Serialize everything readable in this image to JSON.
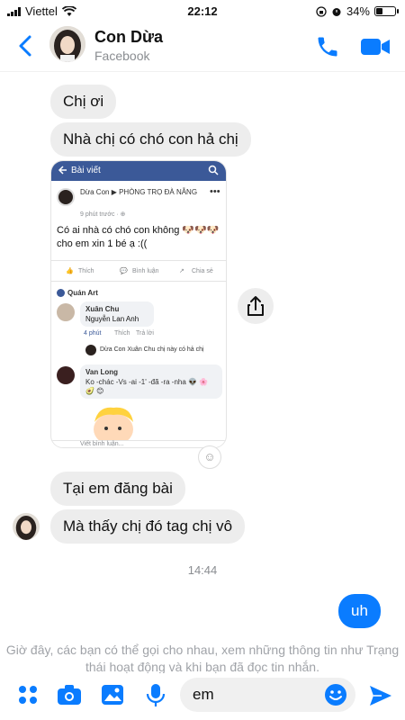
{
  "status": {
    "carrier": "Viettel",
    "time": "22:12",
    "battery": "34%",
    "battery_level": 0.34
  },
  "header": {
    "name": "Con Dừa",
    "subtitle": "Facebook"
  },
  "messages": [
    {
      "from": "them",
      "text": "Chị ơi"
    },
    {
      "from": "them",
      "text": "Nhà chị có chó con hả chị"
    },
    {
      "from": "them",
      "text": "Tại em đăng bài"
    },
    {
      "from": "them",
      "text": "Mà thấy chị đó tag chị vô"
    },
    {
      "from": "me",
      "text": "uh"
    }
  ],
  "timestamp": "14:44",
  "shared_image": {
    "topbar_title": "Bài viết",
    "poster": "Dừa Con ▶ PHÒNG TRỌ ĐÀ NẴNG",
    "post_time": "9 phút trước · ⊕",
    "post_text": "Có ai nhà có chó con không 🐶🐶🐶 cho em xin 1 bé ạ :((",
    "like": "Thích",
    "comment": "Bình luận",
    "share": "Chia sẻ",
    "group_tag": "Quán Art",
    "c1_name": "Xuân Chu",
    "c1_text": "Nguyễn Lan Anh",
    "c1_time": "4 phút",
    "c1_like": "Thích",
    "c1_reply": "Trả lời",
    "reply_text": "Dừa Con Xuân Chu  chị này có hả chị",
    "c2_name": "Van Long",
    "c2_text": "Ko -chác -Vs -ai -1' -đã -ra -nha 👽 🌸 🥑 😊",
    "write_comment": "Viết bình luận..."
  },
  "composer": {
    "notice": "Giờ đây, các bạn có thể gọi cho nhau, xem những thông tin như Trạng thái hoạt động và khi bạn đã đọc tin nhắn.",
    "input_value": "em"
  },
  "colors": {
    "accent": "#0a7cff",
    "fb_blue": "#3b5998",
    "bubble_gray": "#ededed"
  }
}
